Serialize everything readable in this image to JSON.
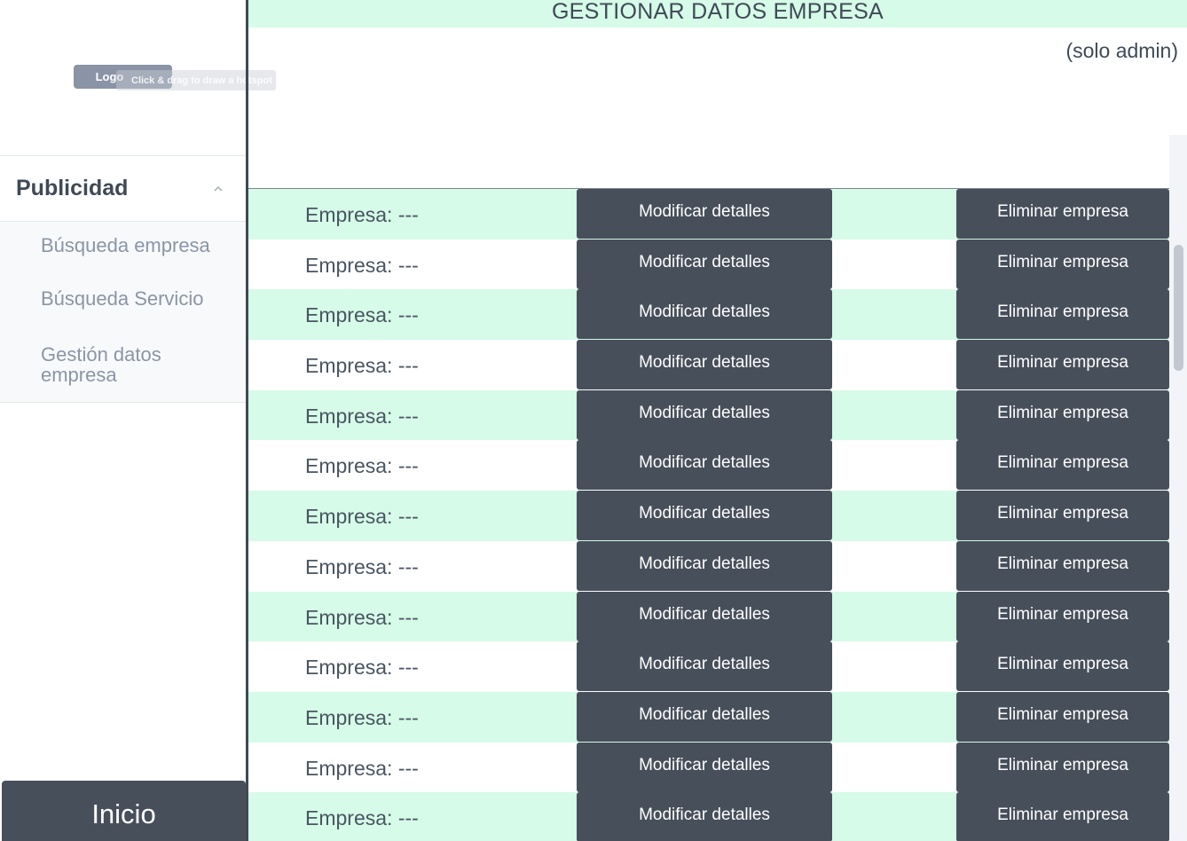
{
  "sidebar": {
    "logo_label": "Logo",
    "hotspot_hint": "Click & drag to draw a hotspot",
    "section_title": "Publicidad",
    "chevron_icon": "chevron-up-icon",
    "items": [
      {
        "label": "Búsqueda empresa"
      },
      {
        "label": "Búsqueda Servicio"
      },
      {
        "label": "Gestión datos empresa"
      }
    ],
    "home_label": "Inicio"
  },
  "main": {
    "title": "GESTIONAR DATOS EMPRESA",
    "admin_note": "(solo admin)",
    "rows": [
      {
        "label": "Empresa: ---",
        "modify_label": "Modificar detalles",
        "delete_label": "Eliminar empresa"
      },
      {
        "label": "Empresa: ---",
        "modify_label": "Modificar detalles",
        "delete_label": "Eliminar empresa"
      },
      {
        "label": "Empresa: ---",
        "modify_label": "Modificar detalles",
        "delete_label": "Eliminar empresa"
      },
      {
        "label": "Empresa: ---",
        "modify_label": "Modificar detalles",
        "delete_label": "Eliminar empresa"
      },
      {
        "label": "Empresa: ---",
        "modify_label": "Modificar detalles",
        "delete_label": "Eliminar empresa"
      },
      {
        "label": "Empresa: ---",
        "modify_label": "Modificar detalles",
        "delete_label": "Eliminar empresa"
      },
      {
        "label": "Empresa: ---",
        "modify_label": "Modificar detalles",
        "delete_label": "Eliminar empresa"
      },
      {
        "label": "Empresa: ---",
        "modify_label": "Modificar detalles",
        "delete_label": "Eliminar empresa"
      },
      {
        "label": "Empresa: ---",
        "modify_label": "Modificar detalles",
        "delete_label": "Eliminar empresa"
      },
      {
        "label": "Empresa: ---",
        "modify_label": "Modificar detalles",
        "delete_label": "Eliminar empresa"
      },
      {
        "label": "Empresa: ---",
        "modify_label": "Modificar detalles",
        "delete_label": "Eliminar empresa"
      },
      {
        "label": "Empresa: ---",
        "modify_label": "Modificar detalles",
        "delete_label": "Eliminar empresa"
      },
      {
        "label": "Empresa: ---",
        "modify_label": "Modificar detalles",
        "delete_label": "Eliminar empresa"
      }
    ]
  },
  "colors": {
    "accent_mint": "#d6fbe8",
    "dark_button": "#474f5b",
    "logo_button": "#8a94a6",
    "text_dark": "#3f4a56",
    "submenu_text": "#8a96a6"
  }
}
